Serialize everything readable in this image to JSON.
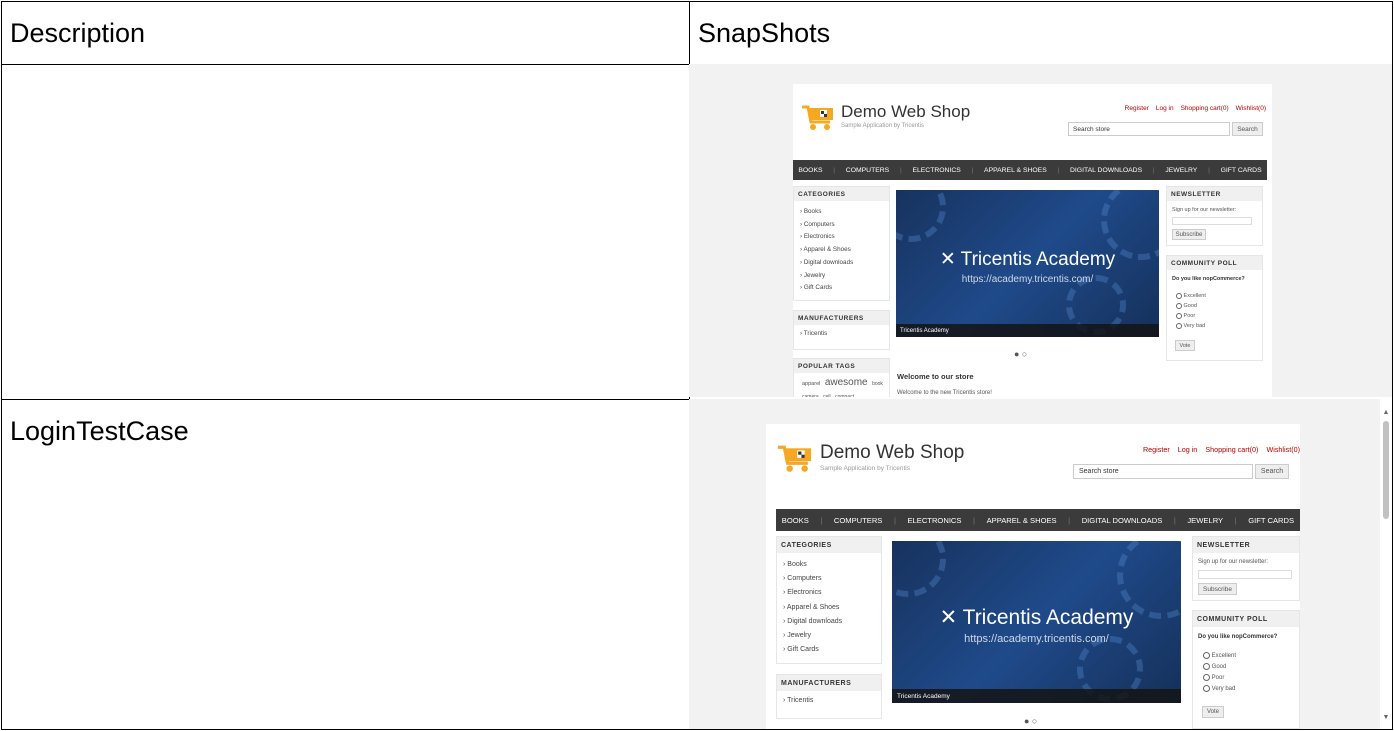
{
  "table": {
    "headers": {
      "description": "Description",
      "snapshots": "SnapShots"
    },
    "rows": [
      {
        "description": ""
      },
      {
        "description": "LoginTestCase"
      }
    ]
  },
  "shop": {
    "title": "Demo Web Shop",
    "subtitle": "Sample Application by Tricentis",
    "header_links": [
      "Register",
      "Log in",
      "Shopping cart(0)",
      "Wishlist(0)"
    ],
    "search_placeholder": "Search store",
    "search_button": "Search",
    "menu": [
      "BOOKS",
      "COMPUTERS",
      "ELECTRONICS",
      "APPAREL & SHOES",
      "DIGITAL DOWNLOADS",
      "JEWELRY",
      "GIFT CARDS"
    ],
    "categories_title": "CATEGORIES",
    "categories": [
      "Books",
      "Computers",
      "Electronics",
      "Apparel & Shoes",
      "Digital downloads",
      "Jewelry",
      "Gift Cards"
    ],
    "manufacturers_title": "MANUFACTURERS",
    "manufacturers": [
      "Tricentis"
    ],
    "popular_tags_title": "POPULAR TAGS",
    "tags": [
      "apparel",
      "awesome",
      "book",
      "camera",
      "cell",
      "compact"
    ],
    "banner_logo": "Tricentis Academy",
    "banner_url": "https://academy.tricentis.com/",
    "banner_caption": "Tricentis Academy",
    "welcome_title": "Welcome to our store",
    "welcome_text": "Welcome to the new Tricentis store!",
    "newsletter_title": "NEWSLETTER",
    "newsletter_label": "Sign up for our newsletter:",
    "subscribe_button": "Subscribe",
    "poll_title": "COMMUNITY POLL",
    "poll_question": "Do you like nopCommerce?",
    "poll_options": [
      "Excellent",
      "Good",
      "Poor",
      "Very bad"
    ],
    "vote_button": "Vote"
  },
  "colors": {
    "link_red": "#b30000",
    "menu_bg": "#3b3b3b",
    "cart_orange": "#f7a823",
    "banner_blue": "#1f4a8a"
  }
}
